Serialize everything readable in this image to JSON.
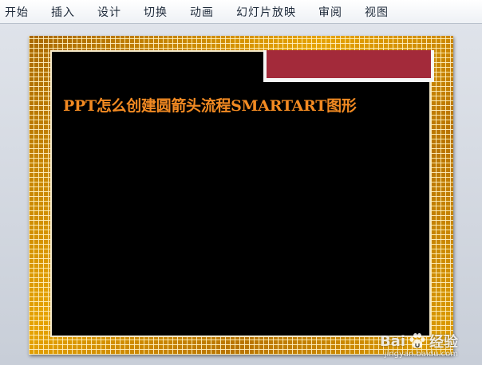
{
  "ribbon": {
    "tabs": [
      {
        "label": "开始"
      },
      {
        "label": "插入"
      },
      {
        "label": "设计"
      },
      {
        "label": "切换"
      },
      {
        "label": "动画"
      },
      {
        "label": "幻灯片放映"
      },
      {
        "label": "审阅"
      },
      {
        "label": "视图"
      }
    ]
  },
  "slide": {
    "title": "PPT怎么创建圆箭头流程SMARTART图形",
    "title_color": "#f28a22",
    "frame_color": "#c98a00",
    "tag_color": "#a32a3a"
  },
  "watermark": {
    "brand_left": "Bai",
    "brand_right": "经验",
    "paw_icon": "baidu-paw-icon",
    "url": "jingyan.baidu.com"
  }
}
